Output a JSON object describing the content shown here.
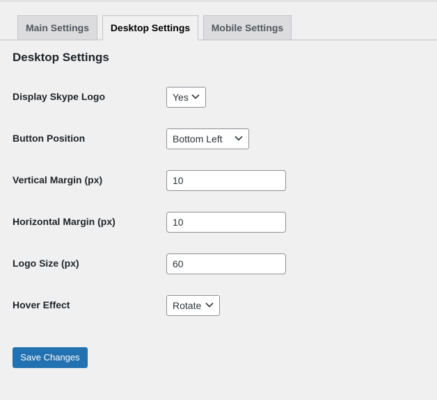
{
  "tabs": [
    {
      "label": "Main Settings",
      "active": false
    },
    {
      "label": "Desktop Settings",
      "active": true
    },
    {
      "label": "Mobile Settings",
      "active": false
    }
  ],
  "section_title": "Desktop Settings",
  "fields": {
    "display_skype_logo": {
      "label": "Display Skype Logo",
      "value": "Yes"
    },
    "button_position": {
      "label": "Button Position",
      "value": "Bottom Left"
    },
    "vertical_margin": {
      "label": "Vertical Margin (px)",
      "value": "10"
    },
    "horizontal_margin": {
      "label": "Horizontal Margin (px)",
      "value": "10"
    },
    "logo_size": {
      "label": "Logo Size (px)",
      "value": "60"
    },
    "hover_effect": {
      "label": "Hover Effect",
      "value": "Rotate"
    }
  },
  "save_label": "Save Changes",
  "icons": {
    "dropdown": "chevron-down-icon"
  },
  "colors": {
    "accent": "#2271b1",
    "background": "#f0f0f1"
  }
}
